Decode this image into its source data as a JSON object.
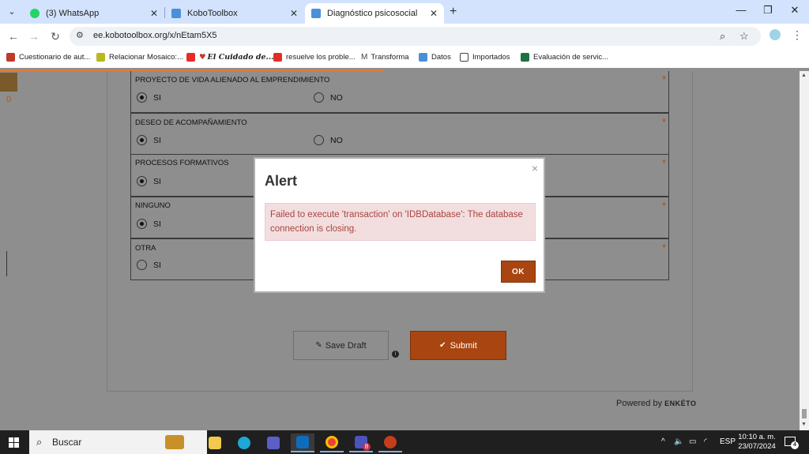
{
  "browser": {
    "tabs": [
      {
        "title": "(3) WhatsApp",
        "favicon": "whatsapp-icon",
        "active": false
      },
      {
        "title": "KoboToolbox",
        "favicon": "kobotoolbox-icon",
        "active": false
      },
      {
        "title": "Diagnóstico psicosocial",
        "favicon": "kobotoolbox-icon",
        "active": true
      }
    ],
    "url": "ee.kobotoolbox.org/x/nEtam5X5",
    "bookmarks": [
      "Cuestionario de aut...",
      "Relacionar Mosaico:...",
      "El Cuidado de...",
      "resuelve los proble...",
      "Transforma",
      "Datos",
      "Importados",
      "Evaluación de servic..."
    ]
  },
  "sidebar": {
    "count": "0"
  },
  "form": {
    "questions": [
      {
        "label": "PROYECTO DE VIDA ALIENADO AL EMPRENDIMIENTO",
        "required": "*",
        "options": [
          {
            "label": "SI",
            "selected": true
          },
          {
            "label": "NO",
            "selected": false
          }
        ]
      },
      {
        "label": "DESEO DE ACOMPAÑAMIENTO",
        "required": "*",
        "options": [
          {
            "label": "SI",
            "selected": true
          },
          {
            "label": "NO",
            "selected": false
          }
        ]
      },
      {
        "label": "PROCESOS FORMATIVOS",
        "required": "*",
        "options": [
          {
            "label": "SI",
            "selected": true
          }
        ]
      },
      {
        "label": "NINGUNO",
        "required": "*",
        "options": [
          {
            "label": "SI",
            "selected": true
          }
        ]
      },
      {
        "label": "OTRA",
        "required": "*",
        "options": [
          {
            "label": "SI",
            "selected": false
          }
        ]
      }
    ],
    "save_draft_label": "Save Draft",
    "submit_label": "Submit",
    "powered_by": "Powered by",
    "brand": "ENKÉTO"
  },
  "modal": {
    "title": "Alert",
    "close": "×",
    "message": "Failed to execute 'transaction' on 'IDBDatabase': The database connection is closing.",
    "ok_label": "OK"
  },
  "taskbar": {
    "search_placeholder": "Buscar",
    "language": "ESP",
    "time": "10:10 a. m.",
    "date": "23/07/2024",
    "teams_badge": "8",
    "notifications": "4"
  },
  "colors": {
    "accent": "#a84510",
    "alert_bg": "#f2dede",
    "alert_text": "#a94442",
    "page_overlay": "#8e8e8e"
  }
}
